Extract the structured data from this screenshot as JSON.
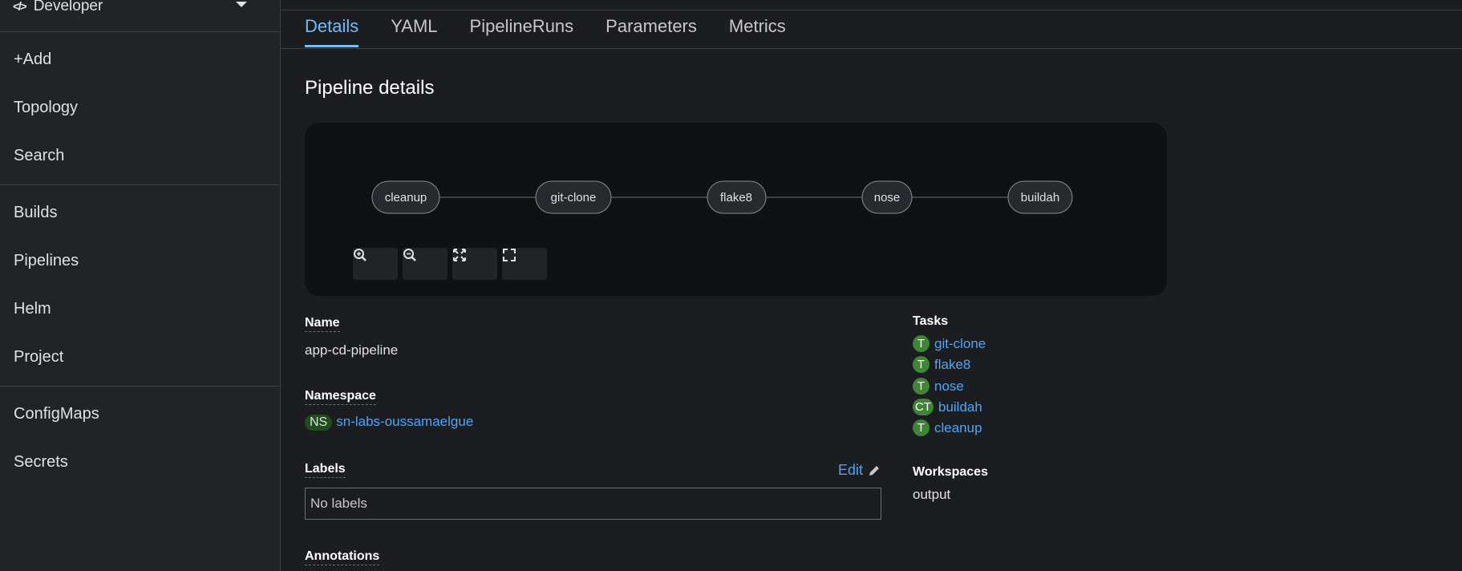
{
  "sidebar": {
    "perspective": "Developer",
    "items": [
      {
        "label": "+Add"
      },
      {
        "label": "Topology"
      },
      {
        "label": "Search"
      },
      {
        "label": "Builds"
      },
      {
        "label": "Pipelines"
      },
      {
        "label": "Helm"
      },
      {
        "label": "Project"
      },
      {
        "label": "ConfigMaps"
      },
      {
        "label": "Secrets"
      }
    ]
  },
  "tabs": [
    {
      "label": "Details",
      "active": true
    },
    {
      "label": "YAML"
    },
    {
      "label": "PipelineRuns"
    },
    {
      "label": "Parameters"
    },
    {
      "label": "Metrics"
    }
  ],
  "page_title": "Pipeline details",
  "pipeline_graph": {
    "nodes": [
      "cleanup",
      "git-clone",
      "flake8",
      "nose",
      "buildah"
    ],
    "controls": [
      "zoom-in-icon",
      "zoom-out-icon",
      "fit-to-screen-icon",
      "expand-icon"
    ]
  },
  "details": {
    "name_label": "Name",
    "name_value": "app-cd-pipeline",
    "namespace_label": "Namespace",
    "namespace_badge": "NS",
    "namespace_value": "sn-labs-oussamaelgue",
    "labels_label": "Labels",
    "labels_edit": "Edit",
    "labels_value": "No labels",
    "annotations_label": "Annotations",
    "tasks_label": "Tasks",
    "tasks": [
      {
        "badge": "T",
        "name": "git-clone"
      },
      {
        "badge": "T",
        "name": "flake8"
      },
      {
        "badge": "T",
        "name": "nose"
      },
      {
        "badge": "CT",
        "name": "buildah"
      },
      {
        "badge": "T",
        "name": "cleanup"
      }
    ],
    "workspaces_label": "Workspaces",
    "workspaces_value": "output"
  },
  "colors": {
    "link": "#4fa6f7",
    "active_tab": "#73bcf7",
    "badge_green": "#3e8635"
  }
}
